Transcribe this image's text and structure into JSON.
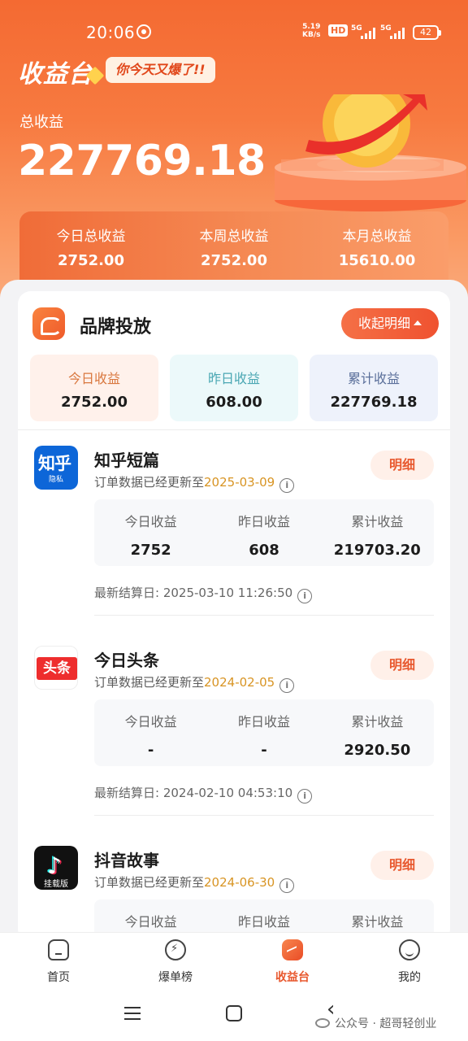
{
  "status_bar": {
    "time": "20:06",
    "net_speed_value": "5.19",
    "net_speed_unit": "KB/s",
    "hd_badge": "HD",
    "sig1_label": "5G",
    "sig2_label": "5G",
    "battery": "42"
  },
  "header": {
    "title": "收益台",
    "slogan": "你今天又爆了!!"
  },
  "total": {
    "label": "总收益",
    "value": "227769.18"
  },
  "summary": [
    {
      "label": "今日总收益",
      "value": "2752.00"
    },
    {
      "label": "本周总收益",
      "value": "2752.00"
    },
    {
      "label": "本月总收益",
      "value": "15610.00"
    }
  ],
  "brand": {
    "title": "品牌投放",
    "collapse_label": "收起明细",
    "stats": [
      {
        "label": "今日收益",
        "value": "2752.00"
      },
      {
        "label": "昨日收益",
        "value": "608.00"
      },
      {
        "label": "累计收益",
        "value": "227769.18"
      }
    ]
  },
  "platforms": [
    {
      "name": "知乎短篇",
      "icon_text": "知乎",
      "icon_subtext": "隐私",
      "update_prefix": "订单数据已经更新至",
      "update_date": "2025-03-09",
      "detail_label": "明细",
      "stats": [
        {
          "label": "今日收益",
          "value": "2752"
        },
        {
          "label": "昨日收益",
          "value": "608"
        },
        {
          "label": "累计收益",
          "value": "219703.20"
        }
      ],
      "settle_label": "最新结算日:",
      "settle_time": "2025-03-10 11:26:50"
    },
    {
      "name": "今日头条",
      "icon_text": "头条",
      "update_prefix": "订单数据已经更新至",
      "update_date": "2024-02-05",
      "detail_label": "明细",
      "stats": [
        {
          "label": "今日收益",
          "value": "-"
        },
        {
          "label": "昨日收益",
          "value": "-"
        },
        {
          "label": "累计收益",
          "value": "2920.50"
        }
      ],
      "settle_label": "最新结算日:",
      "settle_time": "2024-02-10 04:53:10"
    },
    {
      "name": "抖音故事",
      "icon_text": "挂载版",
      "update_prefix": "订单数据已经更新至",
      "update_date": "2024-06-30",
      "detail_label": "明细",
      "stats": [
        {
          "label": "今日收益",
          "value": ""
        },
        {
          "label": "昨日收益",
          "value": ""
        },
        {
          "label": "累计收益",
          "value": ""
        }
      ]
    }
  ],
  "tabbar": [
    {
      "label": "首页",
      "icon": "home-icon"
    },
    {
      "label": "爆单榜",
      "icon": "bolt-icon"
    },
    {
      "label": "收益台",
      "icon": "income-icon",
      "active": true
    },
    {
      "label": "我的",
      "icon": "profile-icon"
    }
  ],
  "watermark": "公众号 · 超哥轻创业",
  "colors": {
    "accent": "#f46a32",
    "detail_text": "#e8582e",
    "date_highlight": "#d89423"
  }
}
